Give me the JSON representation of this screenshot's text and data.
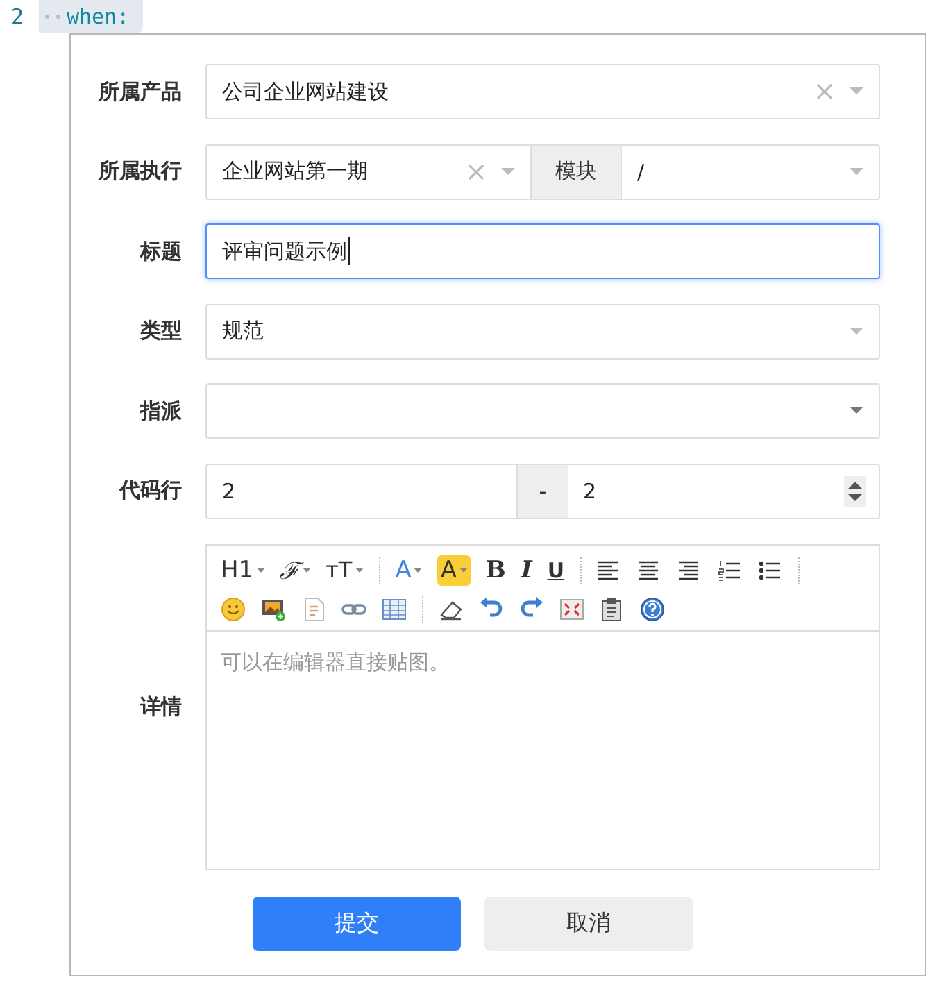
{
  "code_line": {
    "number": "2",
    "text": "when:"
  },
  "fields": [
    {
      "kind": "select",
      "label": "所属产品",
      "value": "公司企业网站建设",
      "clearable": true
    },
    {
      "kind": "select-pair",
      "label": "所属执行",
      "value": "企业网站第一期",
      "clearable": true,
      "addon": "模块",
      "value2": "/"
    },
    {
      "kind": "text",
      "label": "标题",
      "value": "评审问题示例",
      "focused": true
    },
    {
      "kind": "select",
      "label": "类型",
      "value": "规范",
      "clearable": false
    },
    {
      "kind": "native-select",
      "label": "指派"
    },
    {
      "kind": "range",
      "label": "代码行",
      "from": "2",
      "separator": "-",
      "to": "2"
    },
    {
      "kind": "editor",
      "label": "详情",
      "placeholder": "可以在编辑器直接贴图。",
      "toolbar": [
        [
          [
            {
              "kind": "heading",
              "label": "H1"
            },
            {
              "kind": "font-family",
              "label": "ℱ"
            },
            {
              "kind": "font-size",
              "label": "ᴛT"
            }
          ],
          [
            {
              "kind": "font-color",
              "label": "A"
            },
            {
              "kind": "highlight",
              "label": "A"
            },
            {
              "kind": "bold",
              "label": "B"
            },
            {
              "kind": "italic",
              "label": "I"
            },
            {
              "kind": "underline",
              "label": "U"
            }
          ],
          [
            {
              "kind": "align-left"
            },
            {
              "kind": "align-center"
            },
            {
              "kind": "align-right"
            },
            {
              "kind": "ordered-list"
            },
            {
              "kind": "bullet-list"
            }
          ]
        ],
        [
          [
            {
              "kind": "emoticon"
            },
            {
              "kind": "image"
            },
            {
              "kind": "code"
            },
            {
              "kind": "link"
            },
            {
              "kind": "table"
            }
          ],
          [
            {
              "kind": "eraser"
            },
            {
              "kind": "undo"
            },
            {
              "kind": "redo"
            },
            {
              "kind": "fullscreen"
            },
            {
              "kind": "paste"
            },
            {
              "kind": "help"
            }
          ]
        ]
      ]
    }
  ],
  "buttons": [
    {
      "kind": "primary",
      "label": "提交"
    },
    {
      "kind": "secondary",
      "label": "取消"
    }
  ]
}
